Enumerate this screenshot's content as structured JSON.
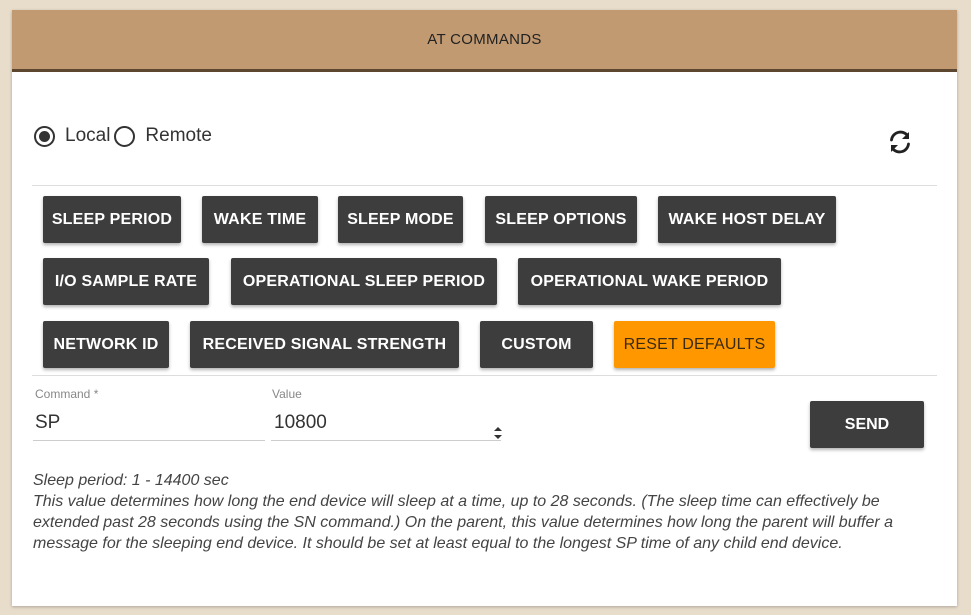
{
  "header": {
    "title": "AT COMMANDS"
  },
  "mode": {
    "options": [
      {
        "label": "Local",
        "selected": true
      },
      {
        "label": "Remote",
        "selected": false
      }
    ]
  },
  "refresh": {
    "icon": "refresh-icon"
  },
  "commands": {
    "row1": [
      "SLEEP PERIOD",
      "WAKE TIME",
      "SLEEP MODE",
      "SLEEP OPTIONS",
      "WAKE HOST DELAY"
    ],
    "row2": [
      "I/O SAMPLE RATE",
      "OPERATIONAL SLEEP PERIOD",
      "OPERATIONAL WAKE PERIOD"
    ],
    "row3": [
      "NETWORK ID",
      "RECEIVED SIGNAL STRENGTH",
      "CUSTOM"
    ],
    "reset": "RESET DEFAULTS"
  },
  "form": {
    "command_label": "Command *",
    "command_value": "SP",
    "value_label": "Value",
    "value_value": "10800",
    "send_label": "SEND"
  },
  "description": {
    "title": "Sleep period: 1 - 14400 sec",
    "body": "This value determines how long the end device will sleep at a time, up to 28 seconds. (The sleep time can effectively be extended past 28 seconds using the SN command.) On the parent, this value determines how long the parent will buffer a message for the sleeping end device. It should be set at least equal to the longest SP time of any child end device."
  },
  "colors": {
    "header_bg": "#c29a72",
    "button_bg": "#3d3d3d",
    "reset_bg": "#ff9800"
  }
}
